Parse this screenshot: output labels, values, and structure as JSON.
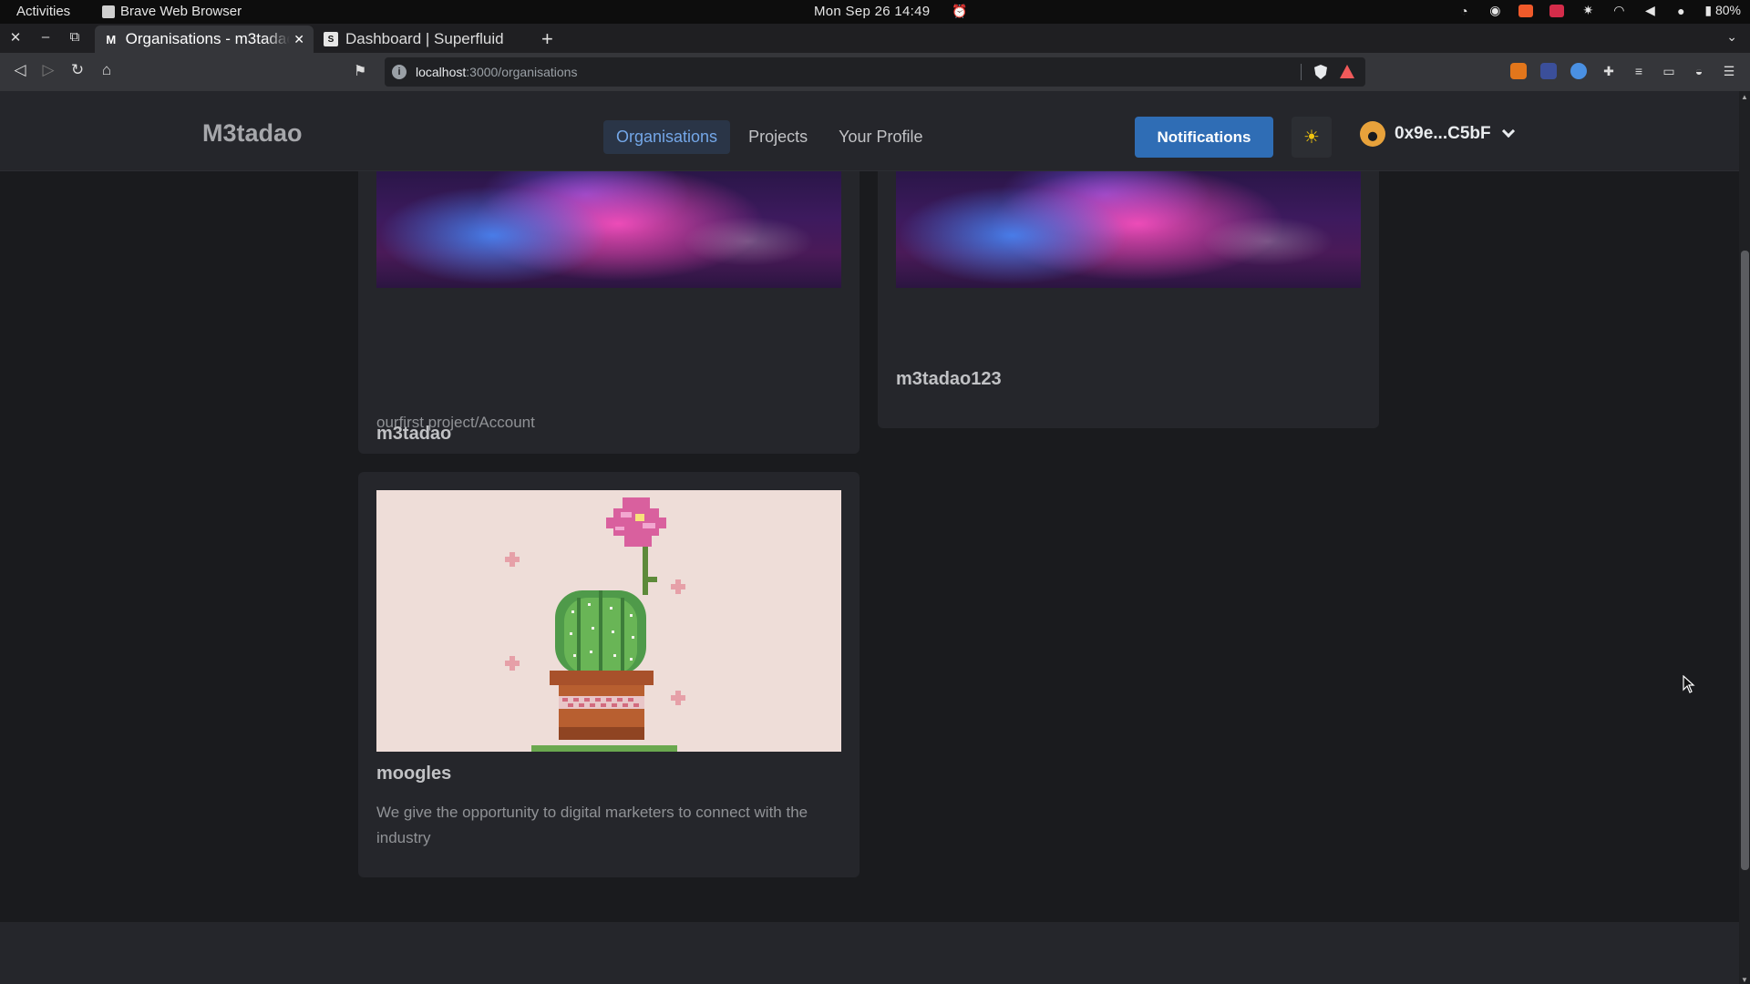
{
  "system": {
    "activities": "Activities",
    "app_name": "Brave Web Browser",
    "clock": "Mon Sep 26  14:49",
    "battery": "80%"
  },
  "browser": {
    "tabs": [
      {
        "title": "Organisations - m3tadao",
        "favicon": "M",
        "active": true
      },
      {
        "title": "Dashboard | Superfluid",
        "favicon": "S",
        "active": false
      }
    ],
    "url_host": "localhost",
    "url_path": ":3000/organisations"
  },
  "header": {
    "brand": "M3tadao",
    "nav": [
      {
        "label": "Organisations",
        "active": true
      },
      {
        "label": "Projects",
        "active": false
      },
      {
        "label": "Your Profile",
        "active": false
      }
    ],
    "notifications_label": "Notifications",
    "account_address": "0x9e...C5bF"
  },
  "organisations": [
    {
      "name": "m3tadao",
      "description": "ourfirst project/Account",
      "image": "nebula"
    },
    {
      "name": "m3tadao123",
      "description": "",
      "image": "nebula"
    },
    {
      "name": "moogles",
      "description": "We give the opportunity to digital marketers to connect with the industry",
      "image": "pixel-cactus"
    }
  ],
  "colors": {
    "accent": "#2f6db5",
    "nav_active_bg": "#2a3547",
    "nav_active_text": "#74a7e8",
    "page_bg": "#1a1b1e",
    "card_bg": "#25262b"
  }
}
